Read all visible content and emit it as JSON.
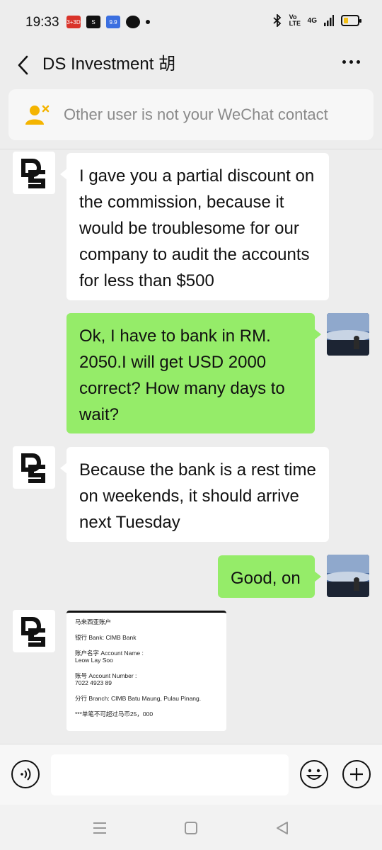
{
  "status_bar": {
    "time": "19:33",
    "app_icons": [
      {
        "name": "app-3d-icon",
        "color": "#d9332a",
        "label": "3+3D"
      },
      {
        "name": "shopee-icon",
        "color": "#111111",
        "label": "S"
      },
      {
        "name": "app-99-icon",
        "color": "#3b6fe0",
        "label": "9.9"
      },
      {
        "name": "app-bird-icon",
        "color": "#111111",
        "label": ""
      }
    ],
    "network": "4G",
    "volte": "Vo LTE",
    "battery_level": 0.35
  },
  "header": {
    "title": "DS Investment 胡",
    "back_icon": "chevron-left-icon",
    "more_icon": "more-horizontal-icon"
  },
  "notice": {
    "text": "Other user is not your WeChat contact",
    "icon": "user-not-contact-icon"
  },
  "messages": [
    {
      "sender": "contact",
      "text": "I gave you a partial discount on the commission, because it would be troublesome for our company to audit the accounts for less than $500"
    },
    {
      "sender": "me",
      "text": "Ok, I have to bank in RM. 2050.I will get USD 2000 correct? How many days to wait?"
    },
    {
      "sender": "contact",
      "text": "Because the bank is a rest time on weekends, it should arrive next Tuesday"
    },
    {
      "sender": "me",
      "text": "Good, on"
    }
  ],
  "image_message": {
    "line1": "马来西亚账户",
    "line2": "银行 Bank: CIMB Bank",
    "line3a": "账户名字 Account Name :",
    "line3b": "Leow Lay Soo",
    "line4a": "账号 Account Number :",
    "line4b": "7022 4923 89",
    "line5": "分行 Branch: CIMB Batu Maung, Pulau Pinang.",
    "line6": "***单笔不可超过马币25，000"
  },
  "input": {
    "value": "",
    "placeholder": ""
  },
  "colors": {
    "bubble_out": "#95ec69",
    "bubble_in": "#ffffff",
    "background": "#ededed"
  }
}
